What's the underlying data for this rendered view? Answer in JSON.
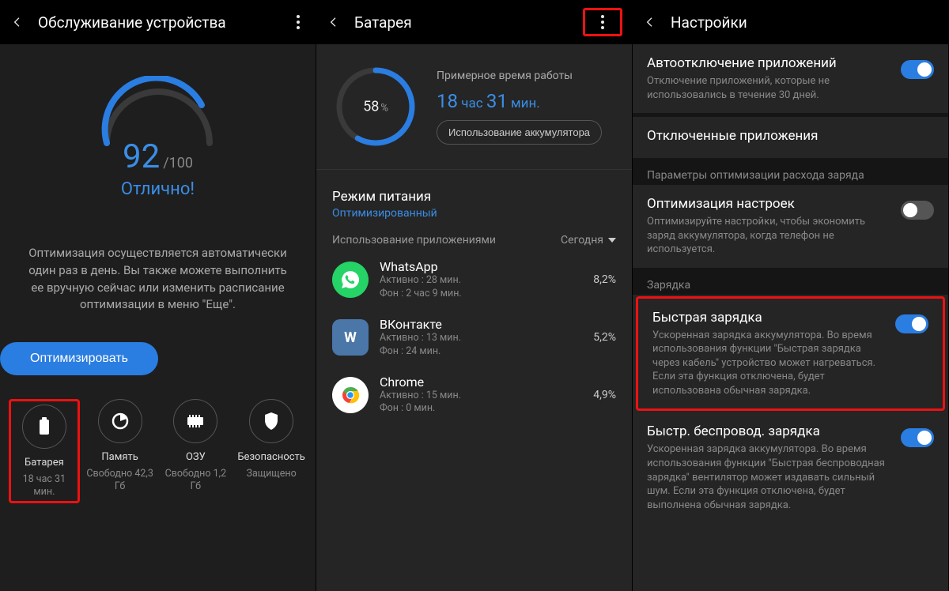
{
  "panel1": {
    "title": "Обслуживание устройства",
    "score": "92",
    "score_max": "/100",
    "score_label": "Отлично!",
    "desc": "Оптимизация осуществляется автоматически один раз в день. Вы также можете выполнить ее вручную сейчас или изменить расписание оптимизации в меню \"Еще\".",
    "optimize_btn": "Оптимизировать",
    "stats": {
      "battery": {
        "name": "Батарея",
        "sub": "18 час 31 мин."
      },
      "memory": {
        "name": "Память",
        "sub": "Свободно 42,3 Гб"
      },
      "ram": {
        "name": "ОЗУ",
        "sub": "Свободно 1,2 Гб"
      },
      "security": {
        "name": "Безопасность",
        "sub": "Защищено"
      }
    }
  },
  "panel2": {
    "title": "Батарея",
    "percent": "58",
    "percent_unit": "%",
    "est_label": "Примерное время работы",
    "est_time_h": "18",
    "est_time_h_u": "час",
    "est_time_m": "31",
    "est_time_m_u": "мин.",
    "usage_btn": "Использование аккумулятора",
    "mode_title": "Режим питания",
    "mode_value": "Оптимизированный",
    "usage_label": "Использование приложениями",
    "today": "Сегодня",
    "apps": [
      {
        "name": "WhatsApp",
        "active": "Активно : 28 мин.",
        "bg": "Фон : 2 час 9 мин.",
        "pct": "8,2%"
      },
      {
        "name": "ВКонтакте",
        "active": "Активно : 13 мин.",
        "bg": "Фон : 24 мин.",
        "pct": "5,2%"
      },
      {
        "name": "Chrome",
        "active": "Активно : 15 мин.",
        "bg": "Фон : 0 мин.",
        "pct": "4,9%"
      }
    ]
  },
  "panel3": {
    "title": "Настройки",
    "items": {
      "auto_off": {
        "title": "Автоотключение приложений",
        "desc": "Отключение приложений, которые не использовались в течение 30 дней."
      },
      "disabled": {
        "title": "Отключенные приложения"
      },
      "cat_opt": "Параметры оптимизации расхода заряда",
      "opt_set": {
        "title": "Оптимизация настроек",
        "desc": "Оптимизируйте настройки, чтобы экономить заряд аккумулятора, когда телефон не используется."
      },
      "cat_charge": "Зарядка",
      "fast": {
        "title": "Быстрая зарядка",
        "desc": "Ускоренная зарядка аккумулятора. Во время использования функции \"Быстрая зарядка через кабель\" устройство может нагреваться. Если эта функция отключена, будет использована обычная зарядка."
      },
      "fast_wl": {
        "title": "Быстр. беспровод. зарядка",
        "desc": "Ускоренная зарядка аккумулятора. Во время использования функции \"Быстрая беспроводная зарядка\" вентилятор может издавать сильный шум. Если эта функция отключена, будет выполнена обычная зарядка."
      }
    }
  }
}
